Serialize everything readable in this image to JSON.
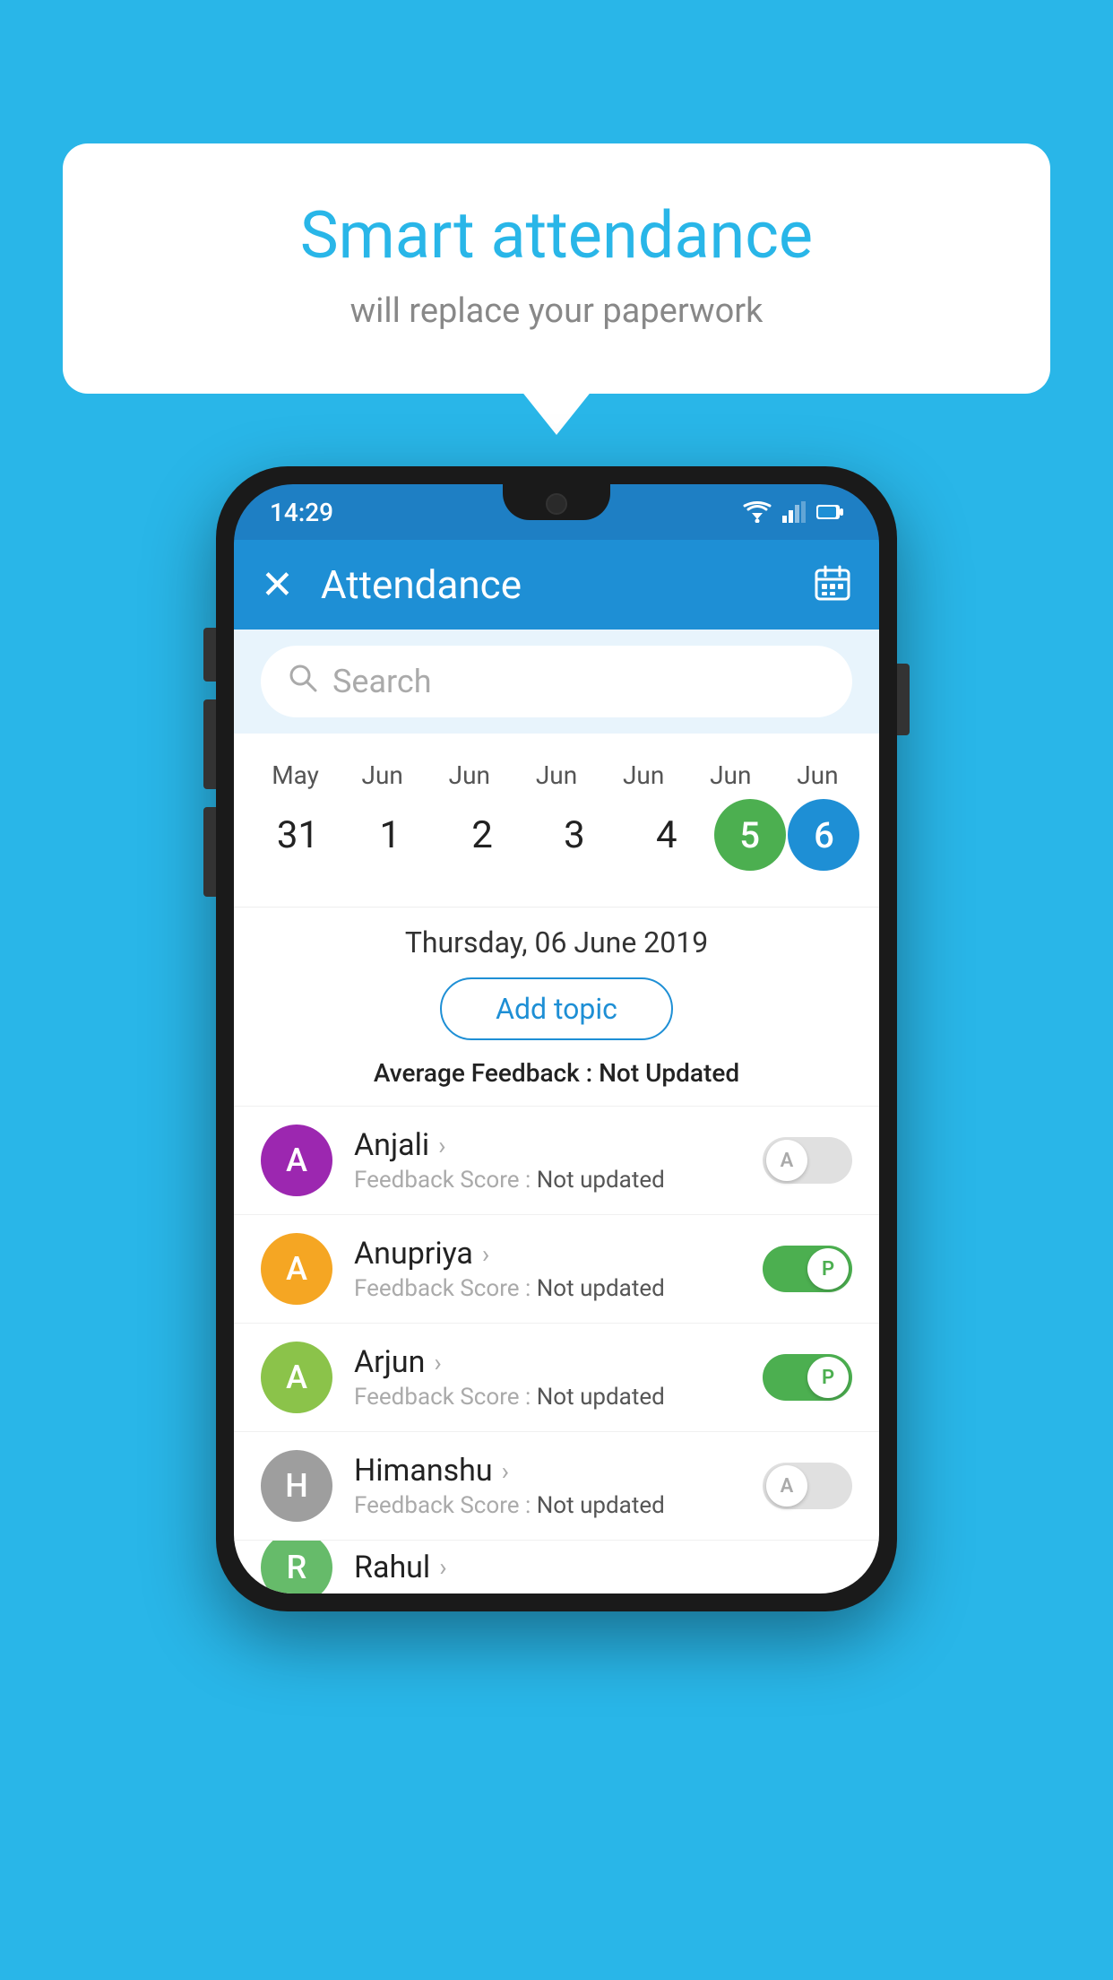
{
  "background_color": "#29b6e8",
  "bubble": {
    "title": "Smart attendance",
    "subtitle": "will replace your paperwork"
  },
  "status_bar": {
    "time": "14:29"
  },
  "app_bar": {
    "title": "Attendance"
  },
  "search": {
    "placeholder": "Search"
  },
  "calendar": {
    "months": [
      "May",
      "Jun",
      "Jun",
      "Jun",
      "Jun",
      "Jun",
      "Jun"
    ],
    "dates": [
      "31",
      "1",
      "2",
      "3",
      "4",
      "5",
      "6"
    ],
    "today_index": 5,
    "selected_index": 6
  },
  "date_info": {
    "full_date": "Thursday, 06 June 2019",
    "add_topic_label": "Add topic",
    "avg_feedback_label": "Average Feedback : ",
    "avg_feedback_value": "Not Updated"
  },
  "students": [
    {
      "name": "Anjali",
      "avatar_letter": "A",
      "avatar_color": "#9c27b0",
      "feedback_label": "Feedback Score : ",
      "feedback_value": "Not updated",
      "toggle": "off",
      "toggle_letter": "A"
    },
    {
      "name": "Anupriya",
      "avatar_letter": "A",
      "avatar_color": "#f5a623",
      "feedback_label": "Feedback Score : ",
      "feedback_value": "Not updated",
      "toggle": "on",
      "toggle_letter": "P"
    },
    {
      "name": "Arjun",
      "avatar_letter": "A",
      "avatar_color": "#8bc34a",
      "feedback_label": "Feedback Score : ",
      "feedback_value": "Not updated",
      "toggle": "on",
      "toggle_letter": "P"
    },
    {
      "name": "Himanshu",
      "avatar_letter": "H",
      "avatar_color": "#9e9e9e",
      "feedback_label": "Feedback Score : ",
      "feedback_value": "Not updated",
      "toggle": "off",
      "toggle_letter": "A"
    }
  ]
}
